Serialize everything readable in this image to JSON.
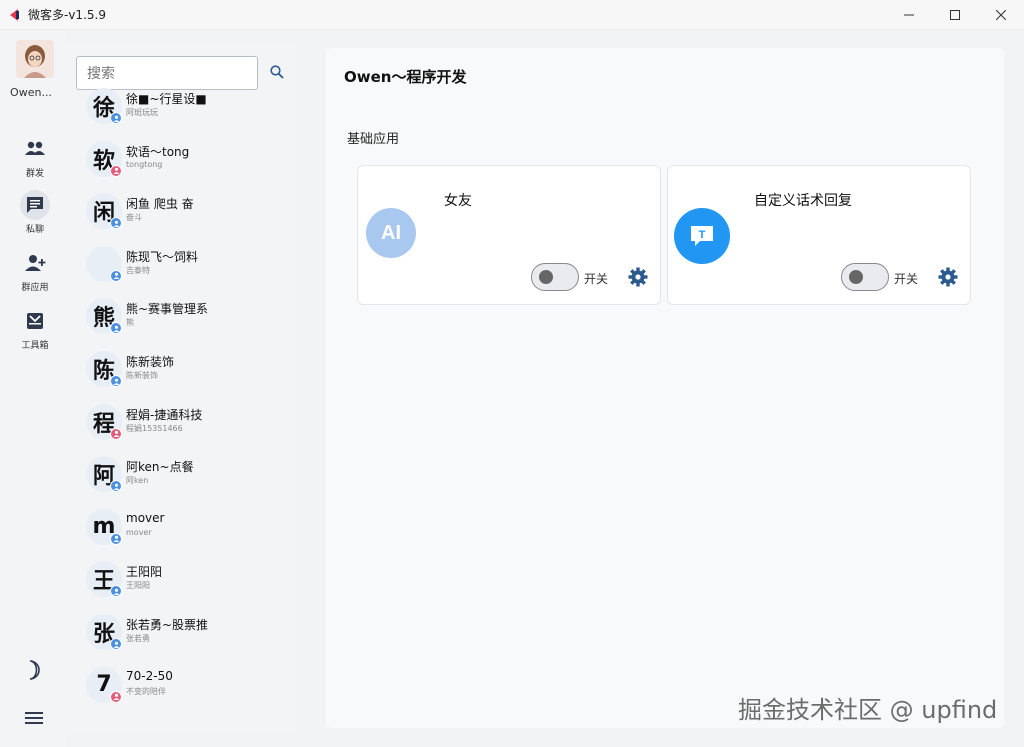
{
  "window": {
    "title": "微客多-v1.5.9"
  },
  "rail": {
    "user_name": "Owen...",
    "items": [
      {
        "label": "群发",
        "icon": "group-icon"
      },
      {
        "label": "私聊",
        "icon": "chat-icon",
        "active": true
      },
      {
        "label": "群应用",
        "icon": "add-user-icon"
      },
      {
        "label": "工具箱",
        "icon": "toolbox-icon"
      }
    ]
  },
  "search": {
    "placeholder": "搜索"
  },
  "contacts": [
    {
      "initial": "徐",
      "name": "徐■~行星设■",
      "sub": "阿斑玩玩",
      "badge": "blue"
    },
    {
      "initial": "软",
      "name": "软语～tong",
      "sub": "tongtong",
      "badge": "pink"
    },
    {
      "initial": "闲",
      "name": "闲鱼 爬虫 奋",
      "sub": "奋斗",
      "badge": "blue"
    },
    {
      "initial": "",
      "name": "陈现飞～饲料",
      "sub": "吉泰特",
      "badge": "blue"
    },
    {
      "initial": "熊",
      "name": "熊~赛事管理系",
      "sub": "熊",
      "badge": "blue"
    },
    {
      "initial": "陈",
      "name": "陈新装饰",
      "sub": "陈新装饰",
      "badge": "blue"
    },
    {
      "initial": "程",
      "name": "程娟-捷通科技",
      "sub": "程娟15351466",
      "badge": "pink"
    },
    {
      "initial": "阿",
      "name": "阿ken~点餐",
      "sub": "阿ken",
      "badge": "blue"
    },
    {
      "initial": "m",
      "name": "mover",
      "sub": "mover",
      "badge": "blue"
    },
    {
      "initial": "王",
      "name": "王阳阳",
      "sub": "王阳阳",
      "badge": "blue"
    },
    {
      "initial": "张",
      "name": "张若勇~股票推",
      "sub": "张若勇",
      "badge": "blue"
    },
    {
      "initial": "7",
      "name": "70-2-50",
      "sub": "不变的陪伴",
      "badge": "pink"
    }
  ],
  "main": {
    "title": "Owen～程序开发",
    "section": "基础应用",
    "cards": [
      {
        "title": "女友",
        "icon_text": "AI",
        "icon_color": "#a9c8ef",
        "toggle_label": "开关",
        "enabled": false
      },
      {
        "title": "自定义话术回复",
        "icon_text": "T",
        "icon_color": "#2196f3",
        "toggle_label": "开关",
        "enabled": false
      }
    ]
  },
  "watermark": "掘金技术社区 @ upfind",
  "colors": {
    "accent": "#2196f3",
    "gear": "#2b5a8e",
    "badge_blue": "#4a90e2",
    "badge_pink": "#e45c7c"
  }
}
